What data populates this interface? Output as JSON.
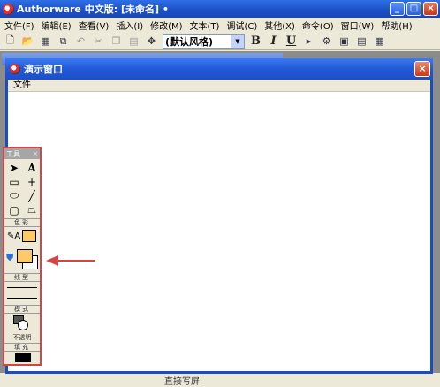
{
  "app": {
    "title": "Authorware 中文版: [未命名] •",
    "buttons": {
      "minimize": "_",
      "maximize": "□",
      "close": "×"
    }
  },
  "menu": [
    "文件(F)",
    "编辑(E)",
    "查看(V)",
    "插入(I)",
    "修改(M)",
    "文本(T)",
    "调试(C)",
    "其他(X)",
    "命令(O)",
    "窗口(W)",
    "帮助(H)"
  ],
  "toolbar": {
    "style_value": "(默认风格)",
    "bold": "B",
    "italic": "I",
    "underline": "U"
  },
  "presentation": {
    "title": "演示窗口",
    "menu": "文件",
    "close": "×"
  },
  "tools": {
    "title": "工具",
    "close": "×",
    "color_label": "色彩",
    "line_label": "线型",
    "mode_label": "模式",
    "opacity_label": "不透明",
    "fill_label": "填充"
  },
  "background": {
    "bottom_text": "直接写屏"
  },
  "colors": {
    "highlight": "#d64545",
    "swatch": "#fdc96a"
  }
}
